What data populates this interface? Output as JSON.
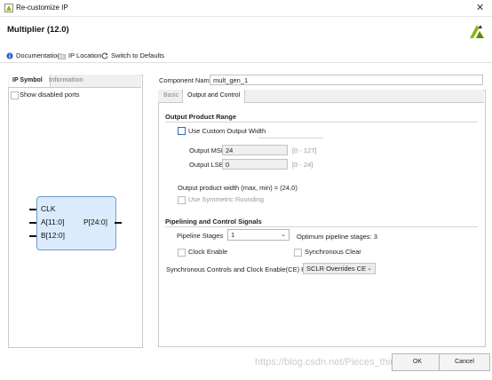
{
  "window": {
    "title": "Re-customize IP",
    "close_glyph": "✕"
  },
  "header": {
    "title": "Multiplier (12.0)"
  },
  "toolbar": {
    "documentation": "Documentation",
    "ip_location": "IP Location",
    "switch_defaults": "Switch to Defaults"
  },
  "left_panel": {
    "tabs": [
      "IP Symbol",
      "Information"
    ],
    "show_disabled_ports": "Show disabled ports",
    "symbol": {
      "ports_left": [
        "CLK",
        "A[11:0]",
        "B[12:0]"
      ],
      "ports_right": [
        "P[24:0]"
      ]
    }
  },
  "component": {
    "label": "Component Name",
    "value": "mult_gen_1"
  },
  "right_tabs": [
    "Basic",
    "Output and Control"
  ],
  "output_range": {
    "section": "Output Product Range",
    "use_custom": "Use Custom Output Width",
    "msb_label": "Output MSB",
    "msb_value": "24",
    "msb_range": "[0 - 127]",
    "lsb_label": "Output LSB",
    "lsb_value": "0",
    "lsb_range": "[0 - 24]",
    "width_note": "Output product width (max, min) = (24,0)",
    "symmetric": "Use Symmetric Rounding"
  },
  "pipelining": {
    "section": "Pipelining and Control Signals",
    "stages_label": "Pipeline Stages",
    "stages_value": "1",
    "optimum": "Optimum pipeline stages: 3",
    "clock_enable": "Clock Enable",
    "sync_clear": "Synchronous Clear",
    "priority_label": "Synchronous Controls and Clock Enable(CE) Priority",
    "priority_value": "SCLR Overrides CE"
  },
  "footer": {
    "ok": "OK",
    "cancel": "Cancel"
  },
  "watermark": "https://blog.csdn.net/Pieces_thinking",
  "colors": {
    "accent_blue": "#2b6cb0",
    "block_fill": "#dcebfb",
    "logo_green": "#8ab800"
  }
}
